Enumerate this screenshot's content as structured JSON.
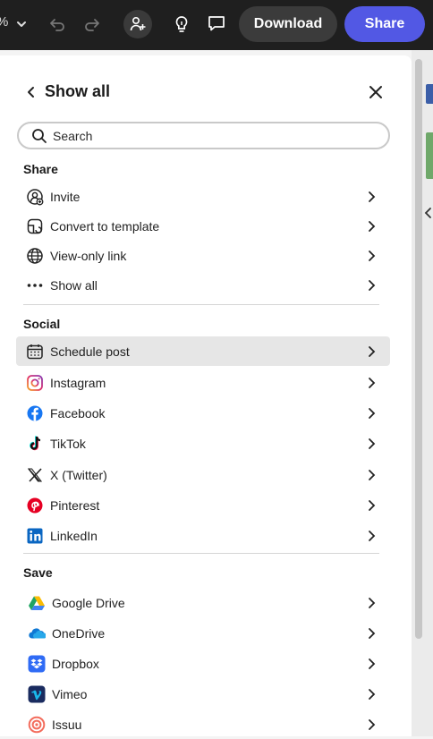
{
  "topbar": {
    "zoom": "%",
    "download_label": "Download",
    "share_label": "Share"
  },
  "panel": {
    "title": "Show all",
    "search": {
      "placeholder": "Search"
    },
    "sections": {
      "share": {
        "title": "Share",
        "items": [
          {
            "label": "Invite",
            "icon": "person-add-icon"
          },
          {
            "label": "Convert to template",
            "icon": "template-icon"
          },
          {
            "label": "View-only link",
            "icon": "globe-icon"
          },
          {
            "label": "Show all",
            "icon": "more-dots-icon"
          }
        ]
      },
      "social": {
        "title": "Social",
        "items": [
          {
            "label": "Schedule post",
            "icon": "calendar-icon"
          },
          {
            "label": "Instagram",
            "icon": "instagram-icon"
          },
          {
            "label": "Facebook",
            "icon": "facebook-icon"
          },
          {
            "label": "TikTok",
            "icon": "tiktok-icon"
          },
          {
            "label": "X (Twitter)",
            "icon": "x-twitter-icon"
          },
          {
            "label": "Pinterest",
            "icon": "pinterest-icon"
          },
          {
            "label": "LinkedIn",
            "icon": "linkedin-icon"
          }
        ]
      },
      "save": {
        "title": "Save",
        "items": [
          {
            "label": "Google Drive",
            "icon": "google-drive-icon"
          },
          {
            "label": "OneDrive",
            "icon": "onedrive-icon"
          },
          {
            "label": "Dropbox",
            "icon": "dropbox-icon"
          },
          {
            "label": "Vimeo",
            "icon": "vimeo-icon"
          },
          {
            "label": "Issuu",
            "icon": "issuu-icon"
          }
        ]
      }
    }
  },
  "colors": {
    "share_accent": "#5258e4",
    "topbar_bg": "#1f1f1f",
    "row_highlight": "#e6e6e6"
  }
}
